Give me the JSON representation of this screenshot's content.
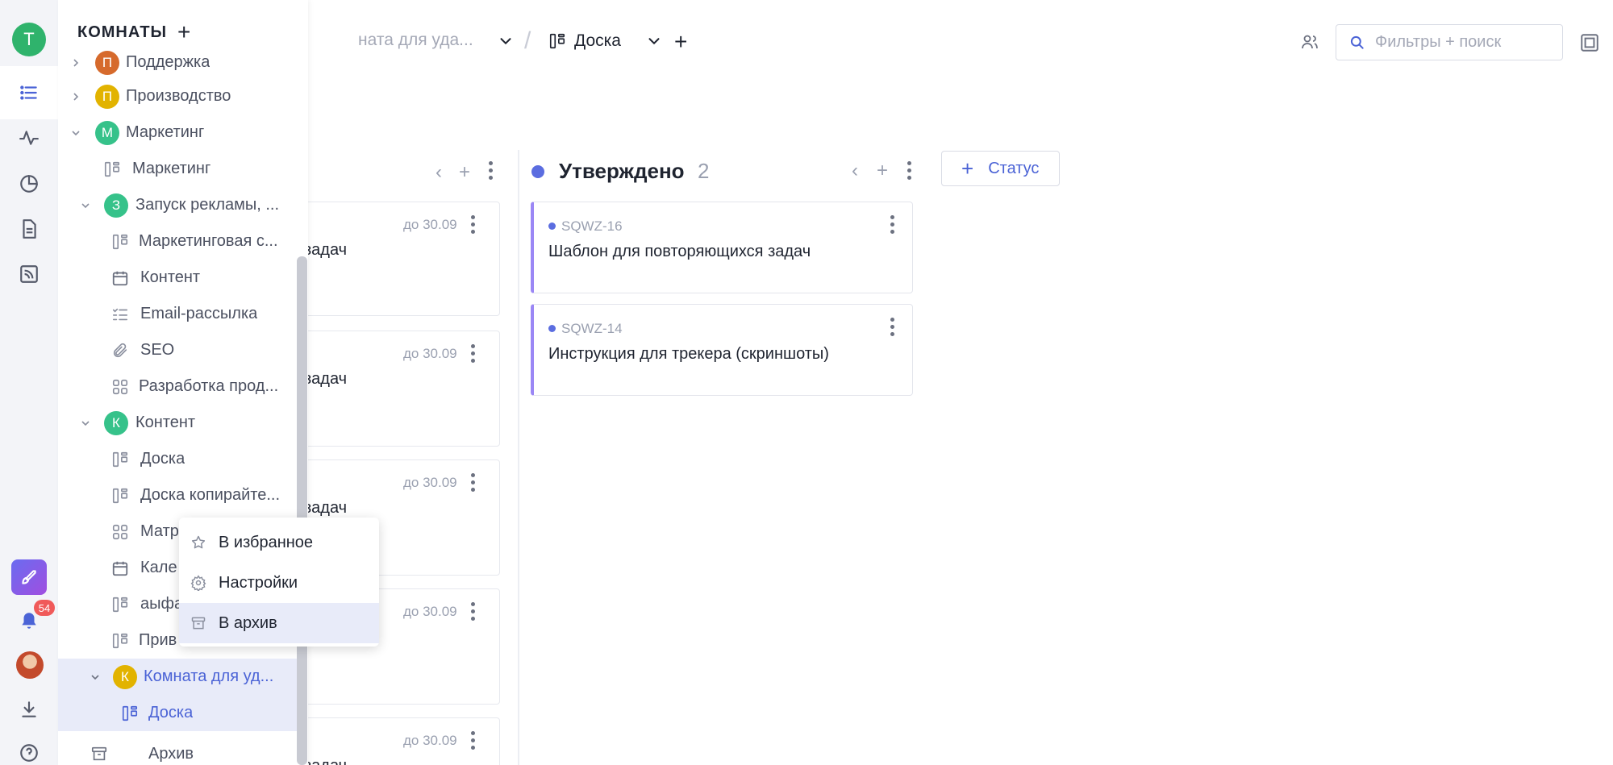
{
  "rail": {
    "workspace_initial": "Т",
    "notification_count": "54",
    "icons": [
      "list-icon",
      "activity-icon",
      "pie-chart-icon",
      "document-icon",
      "feed-icon",
      "rocket-icon",
      "bell-icon",
      "download-icon",
      "help-icon"
    ]
  },
  "header": {
    "room_crumb": "ната для уда...",
    "board_crumb": "Доска",
    "search_placeholder": "Фильтры + поиск"
  },
  "sidebar": {
    "title": "КОМНАТЫ",
    "items": [
      {
        "label": "Поддержка",
        "avatar": "П"
      },
      {
        "label": "Производство",
        "avatar": "П"
      },
      {
        "label": "Маркетинг",
        "avatar": "М"
      },
      {
        "label": "Маркетинг"
      },
      {
        "label": "Запуск рекламы, ...",
        "avatar": "З"
      },
      {
        "label": "Маркетинговая с..."
      },
      {
        "label": "Контент"
      },
      {
        "label": "Email-рассылка"
      },
      {
        "label": "SEO"
      },
      {
        "label": "Разработка прод..."
      },
      {
        "label": "Контент",
        "avatar": "К"
      },
      {
        "label": "Доска"
      },
      {
        "label": "Доска копирайте..."
      },
      {
        "label": "Матр"
      },
      {
        "label": "Кале"
      },
      {
        "label": "аыфа"
      },
      {
        "label": "Прив"
      },
      {
        "label": "Комната для уд...",
        "avatar": "К"
      },
      {
        "label": "Доска"
      }
    ],
    "archive": "Архив"
  },
  "context_menu": {
    "favorite": "В избранное",
    "settings": "Настройки",
    "archive": "В архив"
  },
  "board": {
    "left_column": {
      "cards": [
        {
          "due": "до 30.09",
          "title_fragment": "задач"
        },
        {
          "due": "до 30.09",
          "title_fragment": "задач"
        },
        {
          "due": "до 30.09",
          "title_fragment": "задач"
        },
        {
          "due": "до 30.09",
          "title_fragment": ""
        },
        {
          "due": "до 30.09",
          "title_fragment": "задач"
        }
      ]
    },
    "approved_column": {
      "title": "Утверждено",
      "count": "2",
      "cards": [
        {
          "id": "SQWZ-16",
          "title": "Шаблон для повторяющихся задач"
        },
        {
          "id": "SQWZ-14",
          "title": "Инструкция для трекера (скриншоты)"
        }
      ]
    },
    "status_button": "Статус"
  },
  "colors": {
    "accent": "#4b63d6",
    "highlight": "#e8ebf9",
    "workspace": "#2fb36c",
    "card_border": "#9b87f5"
  }
}
